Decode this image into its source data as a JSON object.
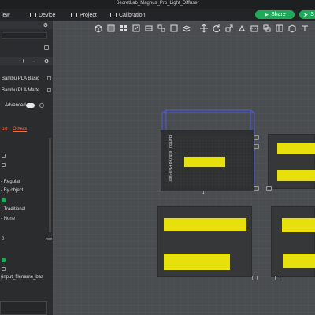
{
  "window": {
    "title": "SecretLab_Magnus_Pro_Light_Diffuser"
  },
  "menu": {
    "view": "iew",
    "device": "Device",
    "project": "Project",
    "calibration": "Calibration",
    "share": "Share",
    "second_button": "S"
  },
  "sidebar": {
    "filaments": [
      "Bambu PLA Basic",
      "Bambu PLA Matte"
    ],
    "advanced_label": "Advanced",
    "tabs": {
      "support": "ort",
      "others": "Others"
    },
    "options": [
      "Regular",
      "By object",
      "Traditional",
      "None"
    ],
    "number_value": "0",
    "number_unit": "mm",
    "filename_format": "{input_filename_bas"
  },
  "plate": {
    "name_label": "Bambu Textured PEI Plate",
    "index": "1"
  },
  "colors": {
    "accent": "#1faa59",
    "object": "#e8e00c",
    "selection": "#4f5bd5",
    "others_tab": "#ff6a3d"
  }
}
